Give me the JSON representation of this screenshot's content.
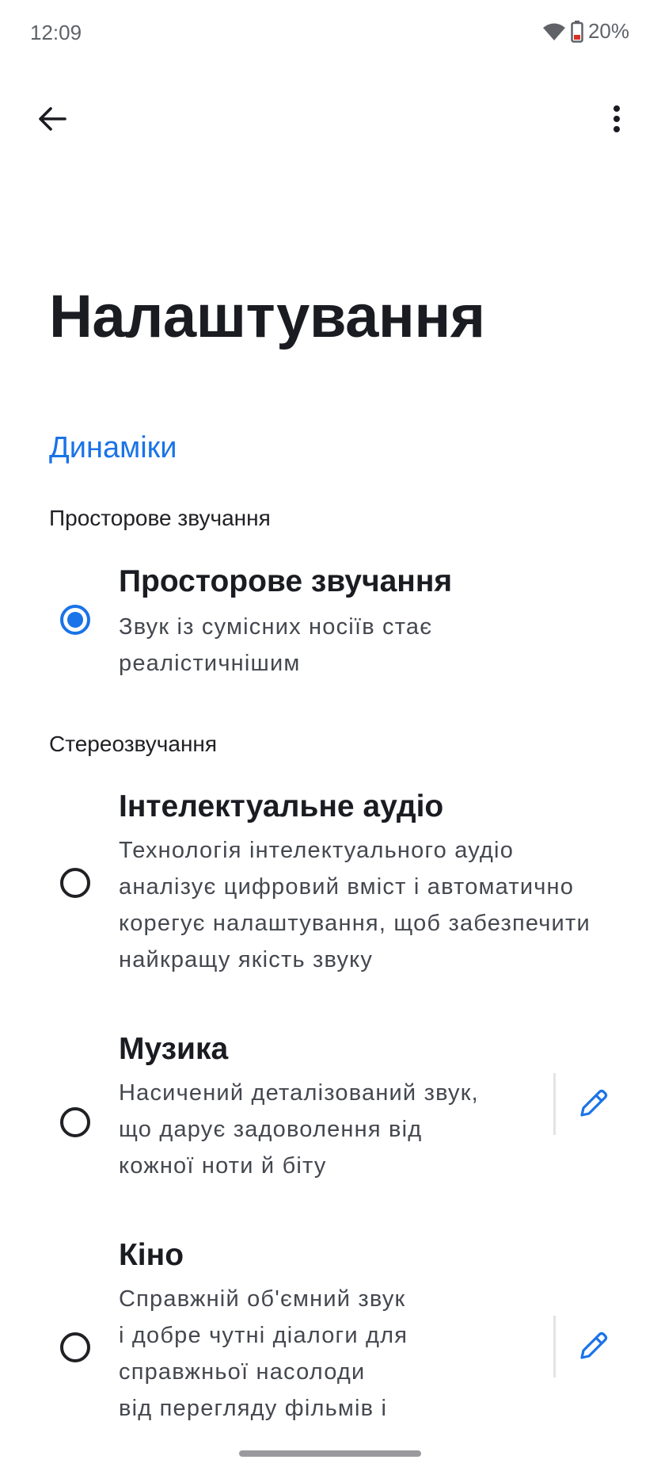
{
  "status": {
    "time": "12:09",
    "battery": "20%"
  },
  "page": {
    "title": "Налаштування"
  },
  "section": {
    "title": "Динаміки"
  },
  "groups": {
    "spatial_label": "Просторове звучання",
    "stereo_label": "Стереозвучання"
  },
  "options": [
    {
      "title": "Просторове звучання",
      "lines": [
        "Звук із сумісних носіїв стає",
        "реалістичнішим"
      ],
      "selected": true
    },
    {
      "title": "Інтелектуальне аудіо",
      "lines": [
        "Технологія інтелектуального аудіо",
        "аналізує цифровий вміст і автоматично",
        "корегує налаштування, щоб забезпечити",
        "найкращу якість звуку"
      ],
      "selected": false
    },
    {
      "title": "Музика",
      "lines": [
        "Насичений деталізований звук,",
        "що дарує задоволення від",
        "кожної ноти й біту"
      ],
      "selected": false
    },
    {
      "title": "Кіно",
      "lines": [
        "Справжній об'ємний звук",
        "і добре чутні діалоги для",
        "справжньої насолоди",
        "від перегляду фільмів і"
      ],
      "selected": false
    }
  ],
  "colors": {
    "accent": "#1a73e8",
    "text": "#1b1c22",
    "secondary": "#44474e"
  },
  "icons": {
    "back": "arrow-left",
    "more": "more-vertical",
    "edit": "pencil",
    "wifi": "wifi",
    "battery": "battery-low"
  }
}
